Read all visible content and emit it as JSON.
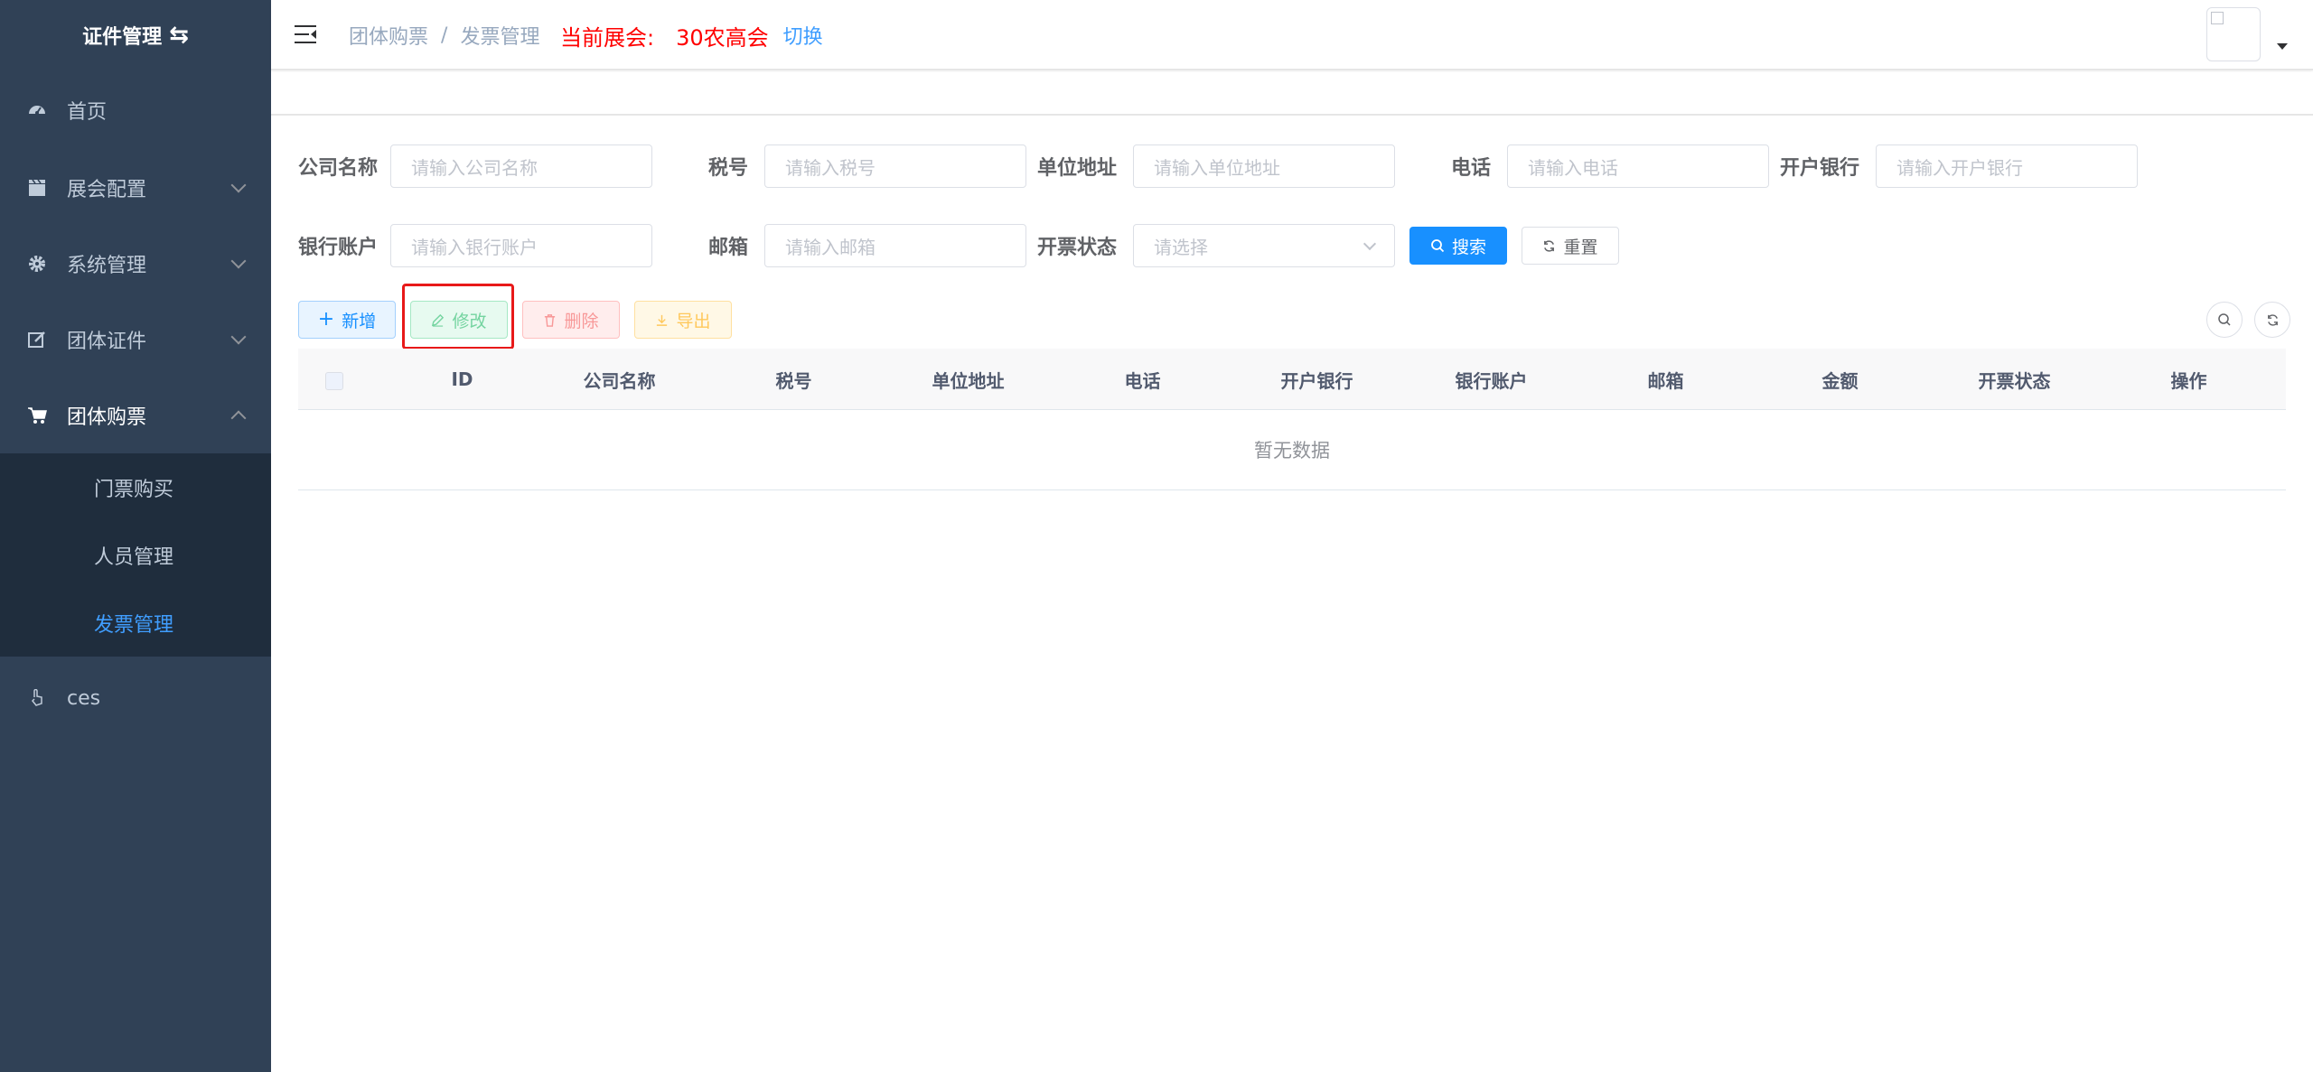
{
  "sidebar": {
    "logo_text": "证件管理",
    "logo_icon": "swap-icon",
    "items": [
      {
        "label": "首页",
        "icon": "dashboard-icon"
      },
      {
        "label": "展会配置",
        "icon": "clapper-icon"
      },
      {
        "label": "系统管理",
        "icon": "gear-icon"
      },
      {
        "label": "团体证件",
        "icon": "edit-icon"
      },
      {
        "label": "团体购票",
        "icon": "cart-icon"
      },
      {
        "label": "ces",
        "icon": "hand-pointer-icon"
      }
    ],
    "submenu": [
      {
        "label": "门票购买"
      },
      {
        "label": "人员管理"
      },
      {
        "label": "发票管理"
      }
    ]
  },
  "header": {
    "breadcrumb": [
      "团体购票",
      "发票管理"
    ],
    "breadcrumb_sep": "/",
    "current_expo_label": "当前展会:",
    "current_expo_name": "30农高会",
    "switch_label": "切换"
  },
  "search_form": {
    "company_name": {
      "label": "公司名称",
      "placeholder": "请输入公司名称"
    },
    "tax_no": {
      "label": "税号",
      "placeholder": "请输入税号"
    },
    "address": {
      "label": "单位地址",
      "placeholder": "请输入单位地址"
    },
    "phone": {
      "label": "电话",
      "placeholder": "请输入电话"
    },
    "bank": {
      "label": "开户银行",
      "placeholder": "请输入开户银行"
    },
    "bank_account": {
      "label": "银行账户",
      "placeholder": "请输入银行账户"
    },
    "email": {
      "label": "邮箱",
      "placeholder": "请输入邮箱"
    },
    "invoice_status": {
      "label": "开票状态",
      "placeholder": "请选择"
    },
    "search_button": "搜索",
    "reset_button": "重置"
  },
  "toolbar": {
    "add": "新增",
    "edit": "修改",
    "delete": "删除",
    "export": "导出"
  },
  "table": {
    "columns": [
      "ID",
      "公司名称",
      "税号",
      "单位地址",
      "电话",
      "开户银行",
      "银行账户",
      "邮箱",
      "金额",
      "开票状态",
      "操作"
    ],
    "empty_text": "暂无数据"
  },
  "colors": {
    "sidebar_bg": "#304156",
    "submenu_bg": "#1f2d3d",
    "primary": "#1890ff",
    "expo_red": "#ff0000",
    "highlight": "#e81919"
  }
}
